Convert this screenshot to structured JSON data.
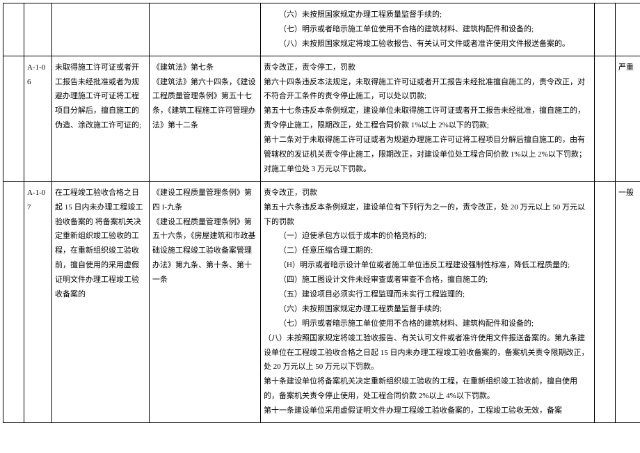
{
  "rows": [
    {
      "c0": "",
      "c1": "",
      "c2": "",
      "c3": "",
      "c4": [
        "（六）未按照国家规定办理工程质量监督手续的;",
        "（七）明示或者暗示施工单位使用不合格的建筑材料、建筑构配件和设备的;",
        "（八）未按照国家规定将竣工验收报告、有关认可文件或者准许使用文件报送备案的。"
      ],
      "c5": "",
      "c6": ""
    },
    {
      "c0": "",
      "c1": "A-1-06",
      "c2": "未取得施工许可证或者开工报告未经批准或者为规避办理施工许可证将工程项目分解后，擅自施工的 伪造、涂改施工许可证的;",
      "c3": "《建筑法》第七条\n《建筑法》第六十四条，《建设工程质量管理条例》第五十七条，《建筑工程施工许可管理办法》第十二条",
      "c4_plain": [
        "责令改正，责令停工，罚款",
        "第六十四条违反本法规定，未取得施工许可证或者开工报告未经批准擅自施工的，责令改正，对不符合开工条件的责令停止施工，可以处以罚款;",
        "第五十七条违反本条例规定，建设单位未取得施工许可证或者开工报告未经批准，擅自施工的，责令停止施工，限期改正，处工程合同价款 1%以上 2%以下的罚款;",
        "第十二条对于未取得施工许可证或者为规避办理施工许可证将工程项目分解后擅自施工的，由有管辖权的发证机关责令停止施工，限期改正，对建设单位处工程合同价款 1%以上 2%以下罚款；对施工单位处 3 万元以下罚款。"
      ],
      "c5": "",
      "c6": "严重"
    },
    {
      "c0": "",
      "c1": "A-1-07",
      "c2": "在工程竣工验收合格之日起 15 日内未办理工程竣工验收备案的 将备案机关决定重新组织竣工验收的工程，在重新组织竣工验收前，擅自使用的采用虚假证明文件办理工程竣工验收备案的",
      "c3": "《建设工程质量管理条例》第四 I-九条\n《建设工程质量管理条例》第五十六条，《房屋建筑和市政基础设施工程竣工验收备案管理办法》第九条、第十条、第十一条",
      "c4_plain": [
        "责令改正，罚款",
        "第五十六条违反本条例规定，建设单位有下列行为之一的，责令改正，处 20 万元以上 50 万元以下的罚款"
      ],
      "c4_indent": [
        "（一）迫使承包方以低于成本的价格竞标的;",
        "（二）任意压缩合理工期的;",
        "（H）明示或者暗示设计单位或者施工单位违反工程建设强制性标准，降低工程质量的;",
        "（四）施工图设计文件未经审查或者审查不合格，擅自施工的;",
        "（五）建设项目必须实行工程监理而未实行工程监理的;",
        "（六）未按照国家规定办理工程质量监督手续的;",
        "（七）明示或者暗示施工单位使用不合格的建筑材料、建筑构配件和设备的;"
      ],
      "c4_tail": [
        "（八）未按照国家规定将竣工验收报告、有关认可文件或者准许使用文件报送备案的。第九条建设单位在工程竣工验收合格之日起 15 日内未办理工程竣工验收备案的，备案机关责令限期改正，处 20 万元以上 50 万元以下罚款。",
        "第十条建设单位将备案机关决定重新组织竣工验收的工程，在重新组织竣工验收前，擅自使用的，备案机关责令停止使用，处工程合同价款 2%以上 4%以下罚款。",
        "第十一条建设单位采用虚假证明文件办理工程竣工验收备案的，工程竣工验收无效，备案"
      ],
      "c5": "",
      "c6": "一般"
    }
  ]
}
